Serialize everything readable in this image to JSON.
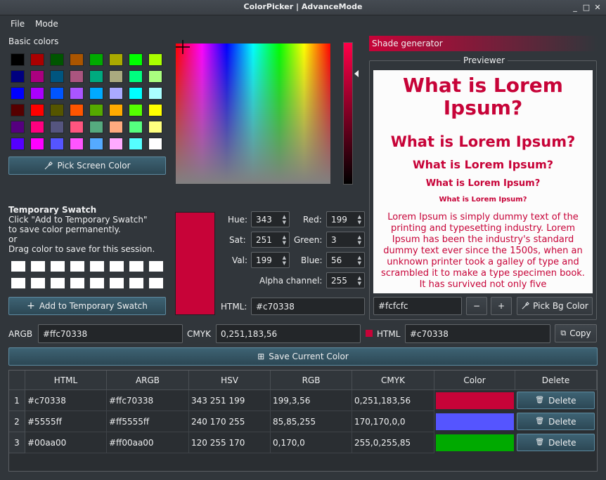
{
  "window": {
    "title": "ColorPicker | AdvanceMode",
    "min": "_",
    "max": "□",
    "close": "✕"
  },
  "menu": {
    "file": "File",
    "mode": "Mode"
  },
  "basic_colors": {
    "label": "Basic colors",
    "rows": [
      [
        "#000000",
        "#aa0000",
        "#005500",
        "#aa5500",
        "#00aa00",
        "#aaaa00",
        "#00ff00",
        "#aaff00"
      ],
      [
        "#00007f",
        "#aa007f",
        "#00557f",
        "#aa557f",
        "#00aa7f",
        "#aaaa7f",
        "#00ff7f",
        "#aaff7f"
      ],
      [
        "#0000ff",
        "#aa00ff",
        "#0055ff",
        "#aa55ff",
        "#00aaff",
        "#aaaaff",
        "#00ffff",
        "#aaffff"
      ],
      [
        "#550000",
        "#ff0000",
        "#555500",
        "#ff5500",
        "#55aa00",
        "#ffaa00",
        "#55ff00",
        "#ffff00"
      ],
      [
        "#55007f",
        "#ff007f",
        "#55557f",
        "#ff557f",
        "#55aa7f",
        "#ffaa7f",
        "#55ff7f",
        "#ffff7f"
      ],
      [
        "#5500ff",
        "#ff00ff",
        "#5555ff",
        "#ff55ff",
        "#55aaff",
        "#ffaaff",
        "#55ffff",
        "#ffffff"
      ]
    ]
  },
  "pick_screen_label": "Pick Screen Color",
  "temp_swatch": {
    "title": "Temporary Swatch",
    "line1": "Click \"Add to Temporary Swatch\"",
    "line2": "to save color permanently.",
    "line3": "or",
    "line4": "Drag color to save for this session.",
    "add_label": "Add to Temporary Swatch"
  },
  "current_color": "#c70338",
  "hsv": {
    "hue_label": "Hue:",
    "hue": "343",
    "sat_label": "Sat:",
    "sat": "251",
    "val_label": "Val:",
    "val": "199"
  },
  "rgb": {
    "red_label": "Red:",
    "red": "199",
    "green_label": "Green:",
    "green": "3",
    "blue_label": "Blue:",
    "blue": "56"
  },
  "alpha": {
    "label": "Alpha channel:",
    "value": "255"
  },
  "html": {
    "label": "HTML:",
    "value": "#c70338"
  },
  "argb": {
    "label": "ARGB",
    "value": "#ffc70338"
  },
  "cmyk": {
    "label": "CMYK",
    "value": "0,251,183,56"
  },
  "html2": {
    "label": "HTML",
    "value": "#c70338"
  },
  "copy_label": "Copy",
  "save_label": "Save Current Color",
  "shade": {
    "label": "Shade generator"
  },
  "previewer": {
    "label": "Previewer",
    "h1": "What is Lorem Ipsum?",
    "h2": "What is Lorem Ipsum?",
    "h3": "What is Lorem Ipsum?",
    "h4": "What is Lorem Ipsum?",
    "h5": "What is Lorem Ipsum?",
    "body": "Lorem Ipsum is simply dummy text of the printing and typesetting industry. Lorem Ipsum has been the industry's standard dummy text ever since the 1500s, when an unknown printer took a galley of type and scrambled it to make a type specimen book. It has survived not only five"
  },
  "bg": {
    "value": "#fcfcfc",
    "minus": "−",
    "plus": "+",
    "pick_label": "Pick Bg Color"
  },
  "table": {
    "headers": [
      "HTML",
      "ARGB",
      "HSV",
      "RGB",
      "CMYK",
      "Color",
      "Delete"
    ],
    "rows": [
      {
        "num": "1",
        "html": "#c70338",
        "argb": "#ffc70338",
        "hsv": "343 251 199",
        "rgb": "199,3,56",
        "cmyk": "0,251,183,56",
        "color": "#c70338",
        "delete": "Delete"
      },
      {
        "num": "2",
        "html": "#5555ff",
        "argb": "#ff5555ff",
        "hsv": "240 170 255",
        "rgb": "85,85,255",
        "cmyk": "170,170,0,0",
        "color": "#5555ff",
        "delete": "Delete"
      },
      {
        "num": "3",
        "html": "#00aa00",
        "argb": "#ff00aa00",
        "hsv": "120 255 170",
        "rgb": "0,170,0",
        "cmyk": "255,0,255,85",
        "color": "#00aa00",
        "delete": "Delete"
      }
    ]
  }
}
